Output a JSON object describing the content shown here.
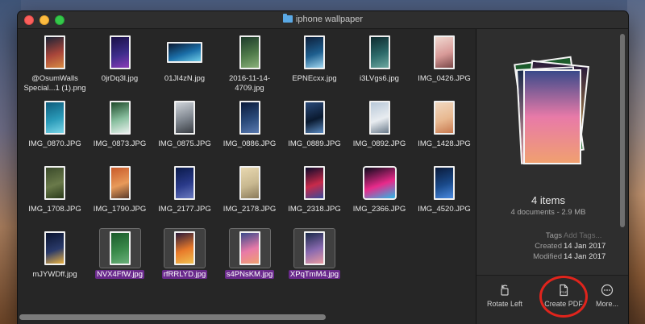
{
  "window": {
    "title": "iphone wallpaper"
  },
  "files": [
    {
      "name": "@OsumWalls Special...1 (1).png",
      "shape": "portrait",
      "colors": [
        "#1b2436",
        "#a8453a",
        "#d88b43"
      ],
      "selected": false
    },
    {
      "name": "0jrDq3l.jpg",
      "shape": "portrait",
      "colors": [
        "#1a1046",
        "#3c2c8a",
        "#8b3bb9"
      ],
      "selected": false
    },
    {
      "name": "01JI4zN.jpg",
      "shape": "landscape",
      "colors": [
        "#0a1830",
        "#1a6ea8",
        "#6fcde8"
      ],
      "selected": false
    },
    {
      "name": "2016-11-14-4709.jpg",
      "shape": "portrait",
      "colors": [
        "#1d3a2a",
        "#4f7a4a",
        "#8ab07a"
      ],
      "selected": false
    },
    {
      "name": "EPNEcxx.jpg",
      "shape": "portrait",
      "colors": [
        "#0d1f3a",
        "#1e5f8f",
        "#9fd6f0"
      ],
      "selected": false
    },
    {
      "name": "i3LVgs6.jpg",
      "shape": "portrait",
      "colors": [
        "#0e2a2e",
        "#2c6a6a",
        "#6ea8a0"
      ],
      "selected": false
    },
    {
      "name": "IMG_0426.JPG",
      "shape": "portrait",
      "colors": [
        "#f0d8d0",
        "#d89a98",
        "#7a4848"
      ],
      "selected": false
    },
    {
      "name": "IMG_0870.JPG",
      "shape": "portrait",
      "colors": [
        "#0e5c7c",
        "#2a9ab8",
        "#7ad6e8"
      ],
      "selected": false
    },
    {
      "name": "IMG_0873.JPG",
      "shape": "portrait",
      "colors": [
        "#1e4a2a",
        "#8ac0a0",
        "#e8f0ec"
      ],
      "selected": false
    },
    {
      "name": "IMG_0875.JPG",
      "shape": "portrait",
      "colors": [
        "#cfd4da",
        "#7e858e",
        "#3a3e44"
      ],
      "selected": false
    },
    {
      "name": "IMG_0886.JPG",
      "shape": "portrait",
      "colors": [
        "#0a1a3a",
        "#2a4a7a",
        "#5a7ab0"
      ],
      "selected": false
    },
    {
      "name": "IMG_0889.JPG",
      "shape": "portrait",
      "colors": [
        "#2a4a7a",
        "#0a1a30",
        "#5a8ac0"
      ],
      "selected": false
    },
    {
      "name": "IMG_0892.JPG",
      "shape": "portrait",
      "colors": [
        "#b8c8d8",
        "#e8ecf0",
        "#6a7a8a"
      ],
      "selected": false
    },
    {
      "name": "IMG_1428.JPG",
      "shape": "portrait",
      "colors": [
        "#f0d8c0",
        "#e8b890",
        "#c87a50"
      ],
      "selected": false
    },
    {
      "name": "IMG_1708.JPG",
      "shape": "portrait",
      "colors": [
        "#3a4a2a",
        "#6a7a4a",
        "#2a3a1a"
      ],
      "selected": false
    },
    {
      "name": "IMG_1790.JPG",
      "shape": "portrait",
      "colors": [
        "#c85a2a",
        "#e89a5a",
        "#5a3a2a"
      ],
      "selected": false
    },
    {
      "name": "IMG_2177.JPG",
      "shape": "portrait",
      "colors": [
        "#0a1a4a",
        "#2a3a8a",
        "#6a7ac0"
      ],
      "selected": false
    },
    {
      "name": "IMG_2178.JPG",
      "shape": "portrait",
      "colors": [
        "#e8d8b0",
        "#c8b890",
        "#8a7a5a"
      ],
      "selected": false
    },
    {
      "name": "IMG_2318.JPG",
      "shape": "portrait",
      "colors": [
        "#0a0a2a",
        "#c82a4a",
        "#3a4a9a"
      ],
      "selected": false
    },
    {
      "name": "IMG_2366.JPG",
      "shape": "square",
      "colors": [
        "#0a0a1a",
        "#e82a8a",
        "#2ab8e8"
      ],
      "selected": false
    },
    {
      "name": "IMG_4520.JPG",
      "shape": "portrait",
      "colors": [
        "#0a1a3a",
        "#1a4a8a",
        "#4a8ae0"
      ],
      "selected": false
    },
    {
      "name": "mJYWDff.jpg",
      "shape": "portrait",
      "colors": [
        "#0a1430",
        "#2a3a6a",
        "#e8b040"
      ],
      "selected": false
    },
    {
      "name": "NVX4FfW.jpg",
      "shape": "portrait",
      "colors": [
        "#1a5a2a",
        "#3a8a4a",
        "#6ab07a"
      ],
      "selected": true
    },
    {
      "name": "rfRRLYD.jpg",
      "shape": "portrait",
      "colors": [
        "#2a1a3a",
        "#e87a2a",
        "#f0c050"
      ],
      "selected": true
    },
    {
      "name": "s4PNsKM.jpg",
      "shape": "portrait",
      "colors": [
        "#3a4a8a",
        "#e87aa8",
        "#f0a070"
      ],
      "selected": true
    },
    {
      "name": "XPqTmM4.jpg",
      "shape": "portrait",
      "colors": [
        "#1a2a4a",
        "#8a6ab0",
        "#e89aa0"
      ],
      "selected": true
    }
  ],
  "preview": {
    "stack_colors": [
      [
        "#1a5a2a",
        "#3a8a4a"
      ],
      [
        "#2a1a3a",
        "#f0c050"
      ],
      [
        "#1a2a4a",
        "#e89aa0"
      ],
      [
        "#3a4a8a",
        "#e87aa8",
        "#f0a070"
      ]
    ],
    "count": "4 items",
    "summary": "4 documents - 2.9 MB",
    "tags_label": "Tags",
    "tags_placeholder": "Add Tags...",
    "created_label": "Created",
    "created_value": "14 Jan 2017",
    "modified_label": "Modified",
    "modified_value": "14 Jan 2017"
  },
  "actions": {
    "rotate_left": "Rotate Left",
    "create_pdf": "Create PDF",
    "more": "More..."
  },
  "colors": {
    "selection": "#6a2a8c",
    "annotation_ring": "#e0241c"
  }
}
